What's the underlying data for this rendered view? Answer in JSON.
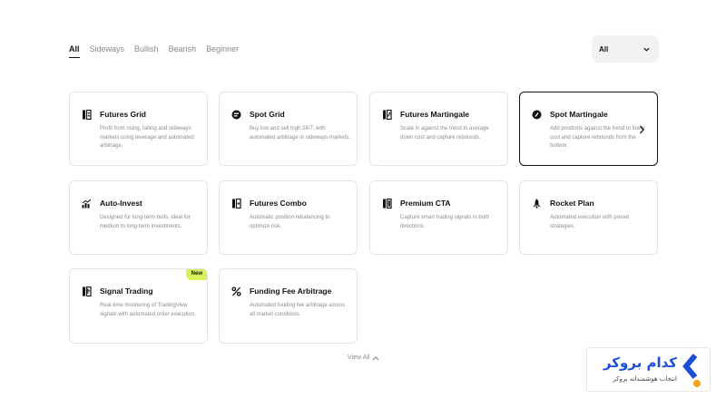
{
  "tabs": [
    {
      "label": "All",
      "active": true
    },
    {
      "label": "Sideways",
      "active": false
    },
    {
      "label": "Bullish",
      "active": false
    },
    {
      "label": "Bearish",
      "active": false
    },
    {
      "label": "Beginner",
      "active": false
    }
  ],
  "filter": {
    "selected": "All",
    "icon": "chevron-down-icon"
  },
  "cards": [
    {
      "title": "Futures Grid",
      "description": "Profit from rising, falling and sideways markets using leverage and automated arbitrage.",
      "icon": "futures-grid-icon"
    },
    {
      "title": "Spot Grid",
      "description": "Buy low and sell high 24/7, with automated arbitrage in sideways markets.",
      "icon": "spot-grid-icon"
    },
    {
      "title": "Futures Martingale",
      "description": "Scale in against the trend to average down cost and capture rebounds.",
      "icon": "futures-martingale-icon"
    },
    {
      "title": "Spot Martingale",
      "description": "Add positions against the trend to lower cost and capture rebounds from the bottom.",
      "icon": "spot-martingale-icon",
      "selected": true
    },
    {
      "title": "Auto-Invest",
      "description": "Designed for long-term bulls, ideal for medium to long-term investments.",
      "icon": "auto-invest-icon"
    },
    {
      "title": "Futures Combo",
      "description": "Automatic position rebalancing to optimize risk.",
      "icon": "futures-combo-icon"
    },
    {
      "title": "Premium CTA",
      "description": "Capture smart trading signals in both directions.",
      "icon": "premium-cta-icon"
    },
    {
      "title": "Rocket Plan",
      "description": "Automated execution with preset strategies.",
      "icon": "rocket-icon"
    },
    {
      "title": "Signal Trading",
      "description": "Real-time monitoring of TradingView signals with automated order execution.",
      "icon": "signal-trading-icon",
      "badge": "New"
    },
    {
      "title": "Funding Fee Arbitrage",
      "description": "Automated funding fee arbitrage across all market conditions.",
      "icon": "percent-icon"
    }
  ],
  "view_all": {
    "label": "View All",
    "icon": "chevron-up-icon"
  },
  "watermark": {
    "brand": "کدام بروکر",
    "tagline": "انتخاب هوشمندانه بروکر",
    "colors": {
      "blue": "#1d4ed8",
      "orange": "#f5a21b"
    }
  },
  "colors": {
    "badge": "#d7f35b",
    "text": "#121212",
    "muted": "#8c8c8c",
    "border": "#e4e4e4"
  }
}
